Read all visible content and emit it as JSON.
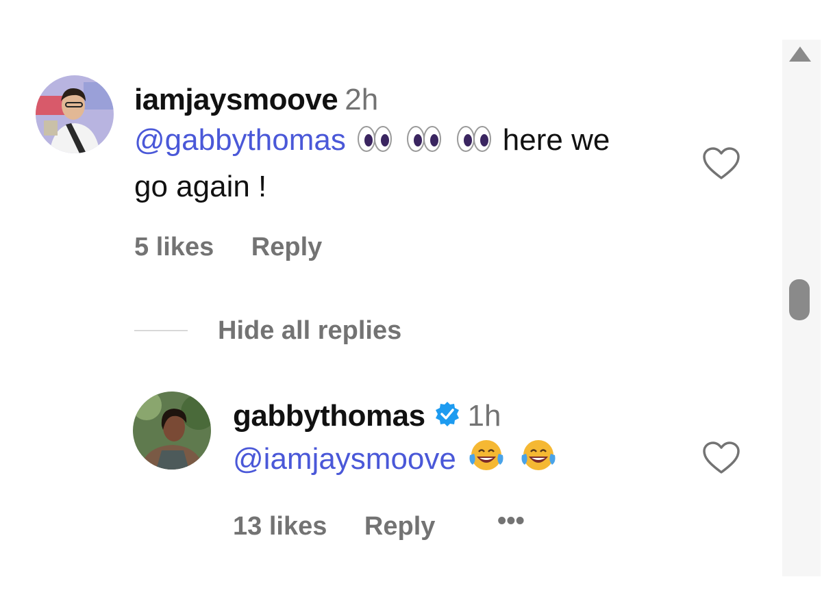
{
  "comments": [
    {
      "username": "iamjaysmoove",
      "time": "2h",
      "mention": "@gabbythomas",
      "text_line1": "here we",
      "text_line2": "go again !",
      "emoji_icons": [
        "eyes-emoji",
        "eyes-emoji",
        "eyes-emoji"
      ],
      "likes": "5 likes",
      "reply_label": "Reply"
    },
    {
      "username": "gabbythomas",
      "verified": true,
      "time": "1h",
      "mention": "@iamjaysmoove",
      "emoji_icons": [
        "tears-of-joy-emoji",
        "tears-of-joy-emoji"
      ],
      "likes": "13 likes",
      "reply_label": "Reply",
      "more_label": "•••"
    }
  ],
  "thread": {
    "hide_replies_label": "Hide all replies"
  },
  "icons": {
    "like": "heart-outline-icon",
    "verified": "verified-badge-icon",
    "scroll_up": "scroll-up-arrow-icon"
  },
  "colors": {
    "mention": "#4a58d8",
    "secondary_text": "#737373",
    "verified": "#1d9bf0"
  }
}
